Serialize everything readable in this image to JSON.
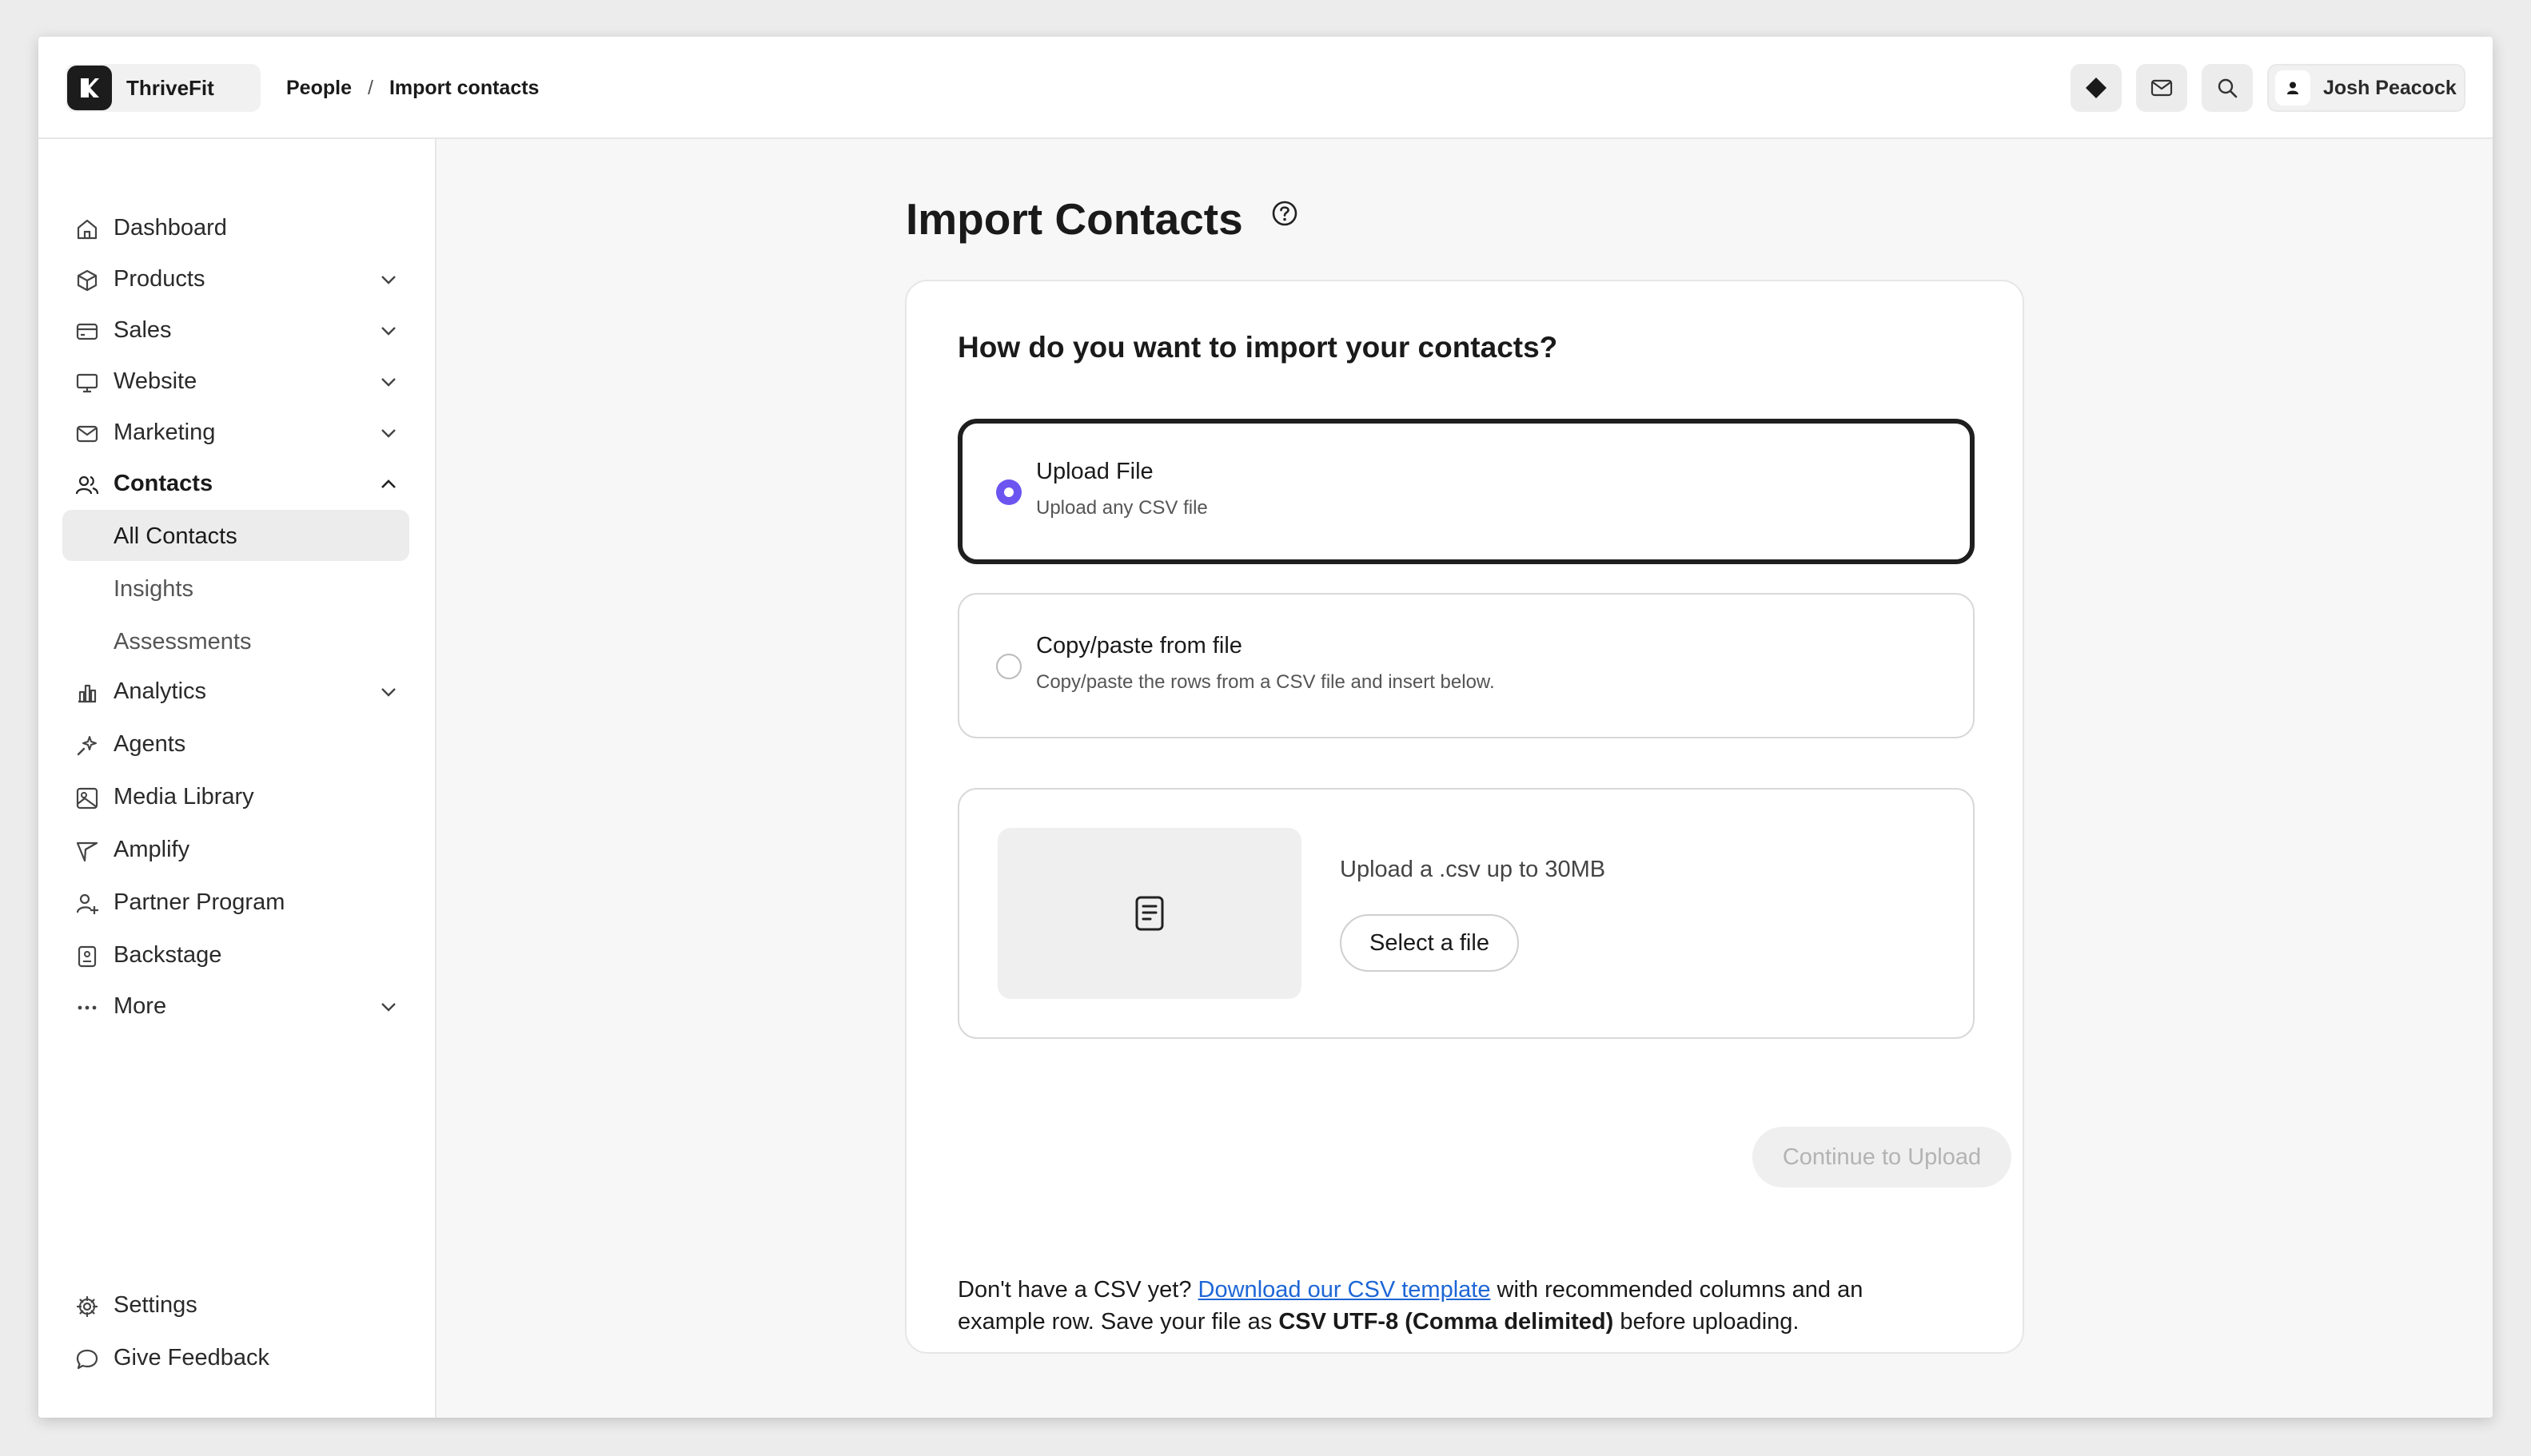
{
  "brand": {
    "name": "ThriveFit"
  },
  "breadcrumb": {
    "parent": "People",
    "separator": "/",
    "current": "Import contacts"
  },
  "topbar": {
    "icons": [
      "diamond-icon",
      "mail-icon",
      "search-icon"
    ],
    "user_name": "Josh Peacock"
  },
  "sidebar": {
    "items": [
      {
        "label": "Dashboard",
        "icon": "home-icon"
      },
      {
        "label": "Products",
        "icon": "box-icon",
        "expandable": true
      },
      {
        "label": "Sales",
        "icon": "credit-card-icon",
        "expandable": true
      },
      {
        "label": "Website",
        "icon": "monitor-icon",
        "expandable": true
      },
      {
        "label": "Marketing",
        "icon": "mail-icon",
        "expandable": true
      },
      {
        "label": "Contacts",
        "icon": "users-icon",
        "expanded": true
      },
      {
        "label": "Analytics",
        "icon": "bar-chart-icon",
        "expandable": true
      },
      {
        "label": "Agents",
        "icon": "sparkle-icon"
      },
      {
        "label": "Media Library",
        "icon": "image-icon"
      },
      {
        "label": "Amplify",
        "icon": "send-icon"
      },
      {
        "label": "Partner Program",
        "icon": "user-plus-icon"
      },
      {
        "label": "Backstage",
        "icon": "badge-icon"
      },
      {
        "label": "More",
        "icon": "ellipsis-icon",
        "expandable": true
      }
    ],
    "contacts_sub": [
      {
        "label": "All Contacts",
        "active": true
      },
      {
        "label": "Insights"
      },
      {
        "label": "Assessments"
      }
    ],
    "footer": [
      {
        "label": "Settings",
        "icon": "gear-icon"
      },
      {
        "label": "Give Feedback",
        "icon": "chat-bubble-icon"
      }
    ]
  },
  "main": {
    "title": "Import Contacts",
    "question": "How do you want to import your contacts?",
    "options": [
      {
        "title": "Upload File",
        "subtitle": "Upload any CSV file",
        "selected": true
      },
      {
        "title": "Copy/paste from file",
        "subtitle": "Copy/paste the rows from a CSV file and insert below.",
        "selected": false
      }
    ],
    "upload": {
      "hint": "Upload a .csv up to 30MB",
      "button": "Select a file"
    },
    "continue_button": "Continue to Upload",
    "footnote": {
      "prefix": "Don't have a CSV yet? ",
      "link": "Download our CSV template",
      "middle": " with recommended columns and an example row. Save your file as ",
      "bold": "CSV UTF-8 (Comma delimited)",
      "suffix": " before uploading."
    }
  },
  "colors": {
    "accent": "#6b55f0",
    "link": "#1d66d6",
    "disabled_text": "#b3b3b3"
  }
}
